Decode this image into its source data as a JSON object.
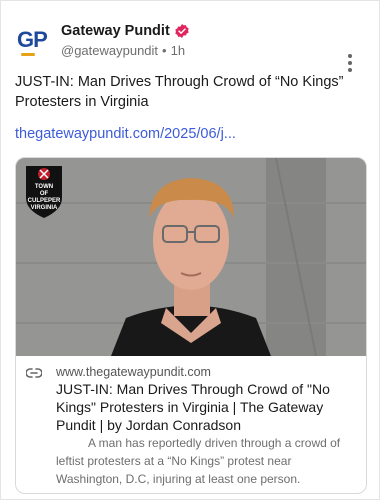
{
  "author": {
    "name": "Gateway Pundit",
    "handle": "@gatewaypundit",
    "separator": "•",
    "time": "1h",
    "avatar_text": "GP",
    "verified_icon": "verified-badge-icon",
    "verified_color": "#e0245e"
  },
  "post": {
    "text": "JUST-IN: Man Drives Through Crowd of “No Kings” Protesters in Virginia",
    "link": "thegatewaypundit.com/2025/06/j..."
  },
  "card": {
    "image_badge_text": [
      "TOWN",
      "OF",
      "CULPEPER",
      "VIRGINIA"
    ],
    "domain": "www.thegatewaypundit.com",
    "title": "JUST-IN: Man Drives Through Crowd of \"No Kings\" Protesters in Virginia | The Gateway Pundit | by Jordan Conradson",
    "description": "A man has reportedly driven through a crowd of leftist protesters at a “No Kings” protest near Washington, D.C, injuring at least one person."
  },
  "colors": {
    "link": "#3d5bd9",
    "brand_blue": "#1f4a9c",
    "brand_orange": "#e8a21a"
  }
}
